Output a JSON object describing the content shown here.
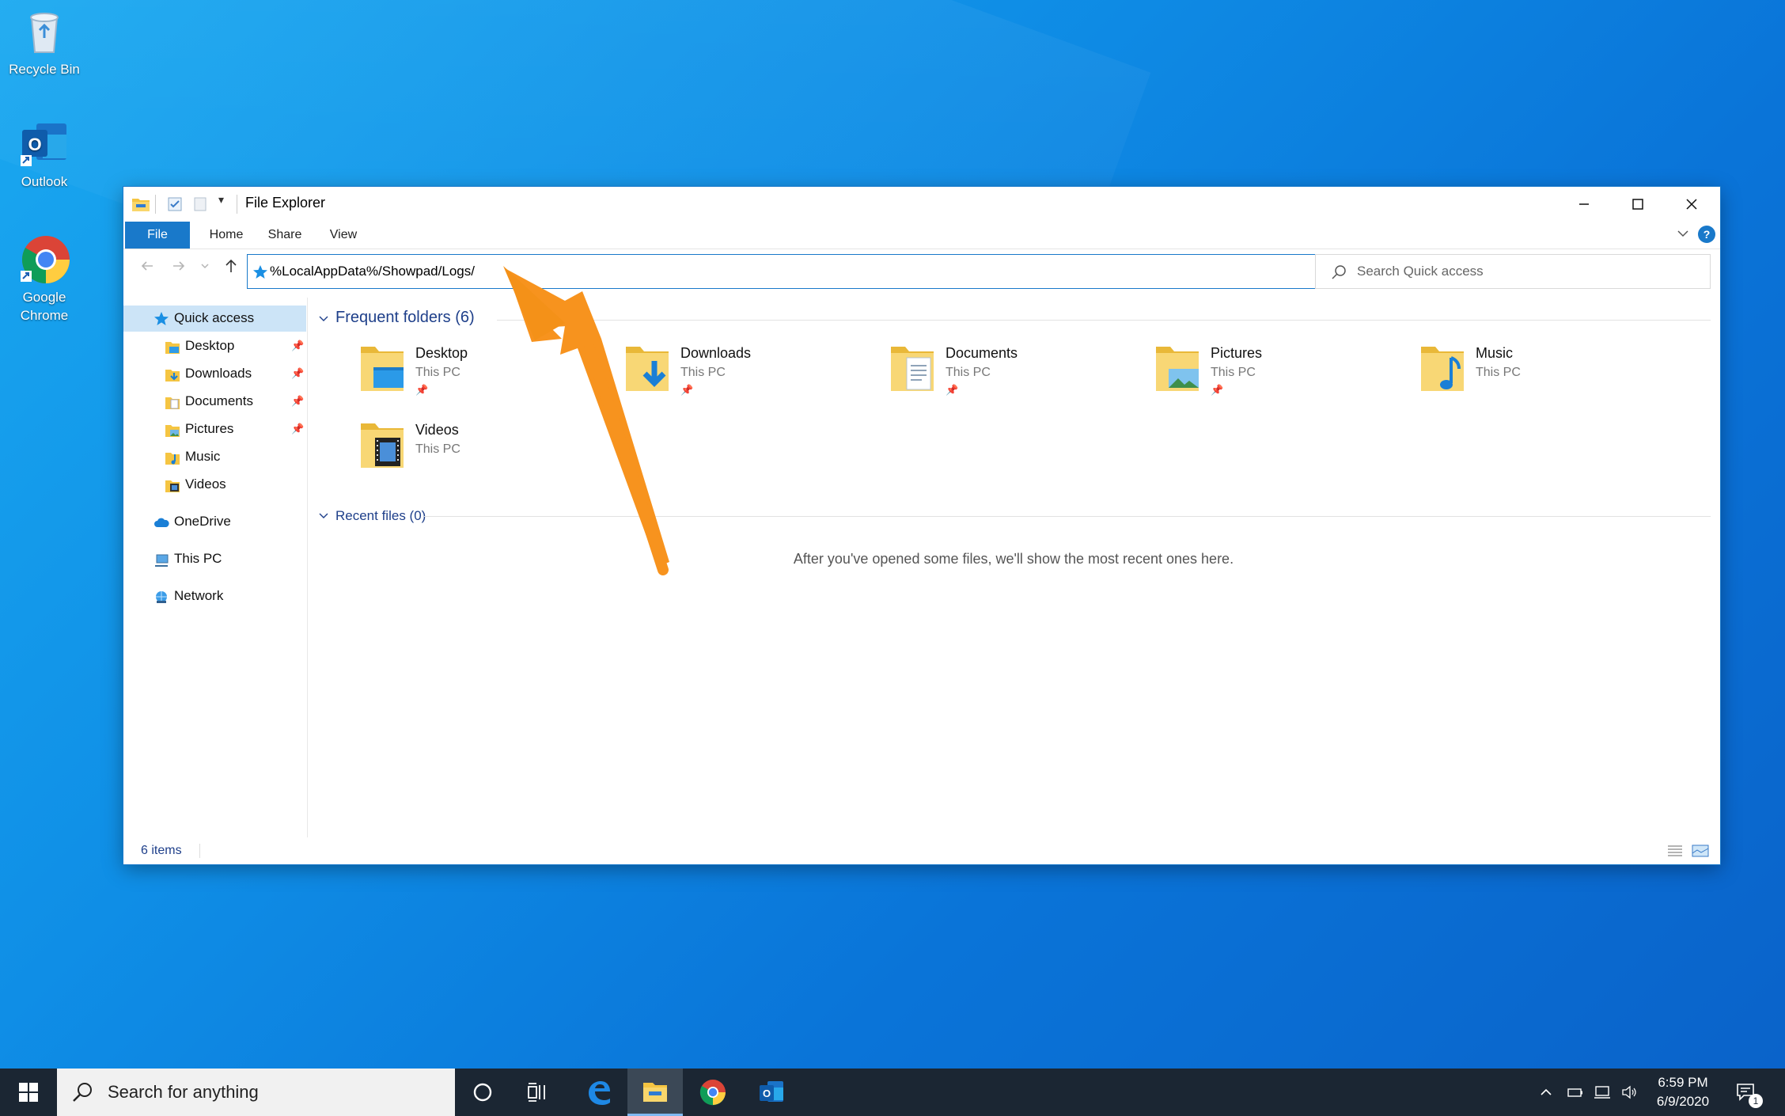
{
  "desktop": {
    "icons": [
      {
        "label": "Recycle Bin"
      },
      {
        "label": "Outlook"
      },
      {
        "label": "Google Chrome"
      }
    ]
  },
  "window": {
    "title": "File Explorer",
    "ribbon_tabs": [
      "File",
      "Home",
      "Share",
      "View"
    ],
    "address_value": "%LocalAppData%/Showpad/Logs/",
    "search_placeholder": "Search Quick access",
    "accent_color": "#1979ca"
  },
  "sidebar": {
    "quick_access": "Quick access",
    "items": [
      {
        "label": "Desktop",
        "pinned": true
      },
      {
        "label": "Downloads",
        "pinned": true
      },
      {
        "label": "Documents",
        "pinned": true
      },
      {
        "label": "Pictures",
        "pinned": true
      },
      {
        "label": "Music",
        "pinned": false
      },
      {
        "label": "Videos",
        "pinned": false
      }
    ],
    "onedrive": "OneDrive",
    "this_pc": "This PC",
    "network": "Network"
  },
  "content": {
    "frequent_header": "Frequent folders (6)",
    "folders": [
      {
        "name": "Desktop",
        "location": "This PC",
        "pinned": true
      },
      {
        "name": "Downloads",
        "location": "This PC",
        "pinned": true
      },
      {
        "name": "Documents",
        "location": "This PC",
        "pinned": true
      },
      {
        "name": "Pictures",
        "location": "This PC",
        "pinned": true
      },
      {
        "name": "Music",
        "location": "This PC",
        "pinned": false
      },
      {
        "name": "Videos",
        "location": "This PC",
        "pinned": false
      }
    ],
    "recent_header": "Recent files (0)",
    "recent_empty": "After you've opened some files, we'll show the most recent ones here."
  },
  "status": {
    "items": "6 items"
  },
  "taskbar": {
    "search_placeholder": "Search for anything",
    "time": "6:59 PM",
    "date": "6/9/2020",
    "notification_count": "1"
  }
}
